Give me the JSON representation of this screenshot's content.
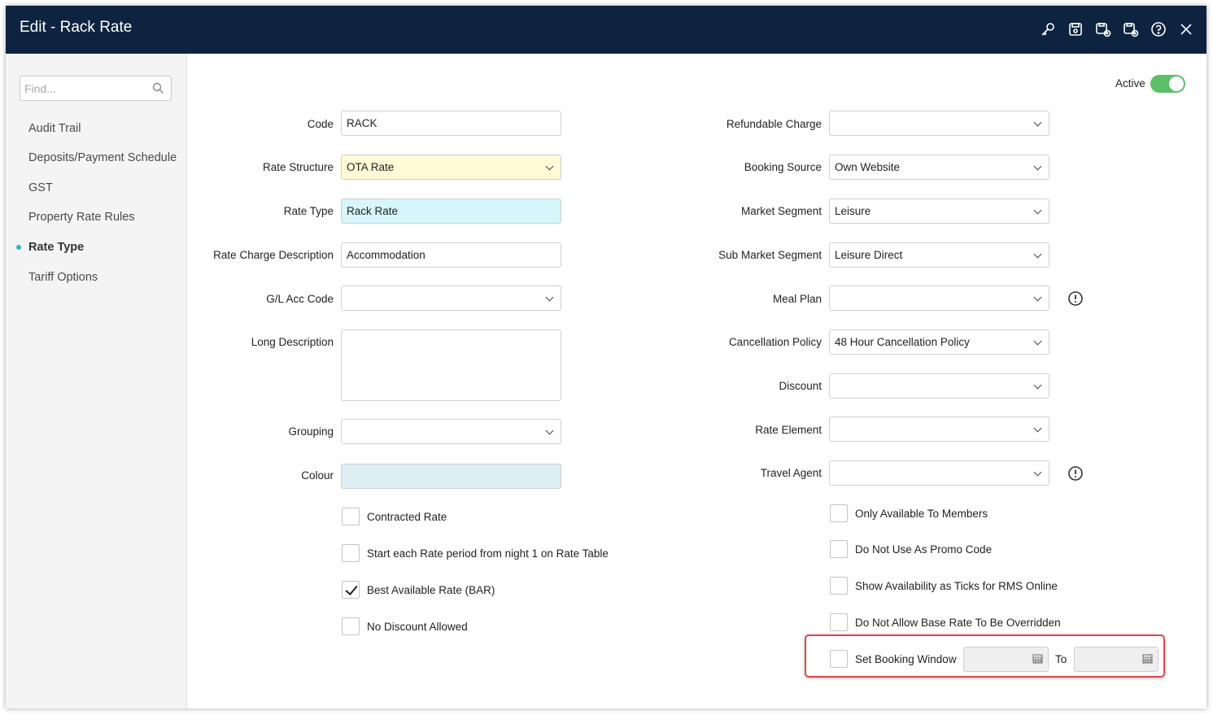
{
  "window": {
    "title": "Edit - Rack Rate"
  },
  "toolbar": {
    "icons": [
      "key-icon",
      "save-icon",
      "save-new-icon",
      "save-close-icon",
      "help-icon",
      "close-icon"
    ]
  },
  "sidebar": {
    "search_placeholder": "Find...",
    "items": [
      {
        "label": "Audit Trail",
        "active": false
      },
      {
        "label": "Deposits/Payment Schedule",
        "active": false
      },
      {
        "label": "GST",
        "active": false
      },
      {
        "label": "Property Rate Rules",
        "active": false
      },
      {
        "label": "Rate Type",
        "active": true
      },
      {
        "label": "Tariff Options",
        "active": false
      }
    ]
  },
  "status": {
    "active_label": "Active",
    "active": true
  },
  "left_fields": {
    "code": {
      "label": "Code",
      "value": "RACK"
    },
    "rate_structure": {
      "label": "Rate Structure",
      "value": "OTA Rate"
    },
    "rate_type": {
      "label": "Rate Type",
      "value": "Rack Rate"
    },
    "rate_charge_description": {
      "label": "Rate Charge Description",
      "value": "Accommodation"
    },
    "gl_acc_code": {
      "label": "G/L Acc Code",
      "value": ""
    },
    "long_description": {
      "label": "Long Description",
      "value": ""
    },
    "grouping": {
      "label": "Grouping",
      "value": ""
    },
    "colour": {
      "label": "Colour",
      "value": ""
    }
  },
  "left_checkboxes": [
    {
      "label": "Contracted Rate",
      "checked": false
    },
    {
      "label": "Start each Rate period from night 1 on Rate Table",
      "checked": false
    },
    {
      "label": "Best Available Rate (BAR)",
      "checked": true
    },
    {
      "label": "No Discount Allowed",
      "checked": false
    }
  ],
  "right_fields": {
    "refundable_charge": {
      "label": "Refundable Charge",
      "value": ""
    },
    "booking_source": {
      "label": "Booking Source",
      "value": "Own Website"
    },
    "market_segment": {
      "label": "Market Segment",
      "value": "Leisure"
    },
    "sub_market_segment": {
      "label": "Sub Market Segment",
      "value": "Leisure Direct"
    },
    "meal_plan": {
      "label": "Meal Plan",
      "value": ""
    },
    "cancellation_policy": {
      "label": "Cancellation Policy",
      "value": "48 Hour Cancellation Policy"
    },
    "discount": {
      "label": "Discount",
      "value": ""
    },
    "rate_element": {
      "label": "Rate Element",
      "value": ""
    },
    "travel_agent": {
      "label": "Travel Agent",
      "value": ""
    }
  },
  "right_checkboxes": [
    {
      "label": "Only Available To Members",
      "checked": false
    },
    {
      "label": "Do Not Use As Promo Code",
      "checked": false
    },
    {
      "label": "Show Availability as Ticks for RMS Online",
      "checked": false
    },
    {
      "label": "Do Not Allow Base Rate To Be Overridden",
      "checked": false
    }
  ],
  "booking_window": {
    "label": "Set Booking Window",
    "checked": false,
    "to_label": "To",
    "from_value": "",
    "to_value": ""
  },
  "colors": {
    "titlebar": "#0e2340",
    "toggle_on": "#5cbf6a",
    "highlight": "#e0464e",
    "nav_dot": "#2bb5c9"
  }
}
